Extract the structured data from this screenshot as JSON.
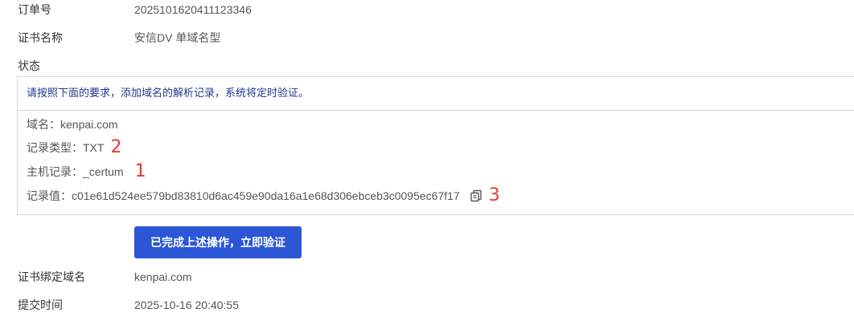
{
  "order": {
    "label": "订单号",
    "value": "2025101620411123346"
  },
  "cert_name": {
    "label": "证书名称",
    "value": "安信DV 单域名型"
  },
  "status": {
    "label": "状态",
    "notice": "请按照下面的要求，添加域名的解析记录，系统将定时验证。",
    "domain_label": "域名：",
    "domain_value": "kenpai.com",
    "record_type_label": "记录类型：",
    "record_type_value": "TXT",
    "host_record_label": "主机记录：",
    "host_record_value": "_certum",
    "record_value_label": "记录值：",
    "record_value": "c01e61d524ee579bd83810d6ac459e90da16a1e68d306ebceb3c0095ec67f17",
    "markers": {
      "record_type": "2",
      "host_record": "1",
      "record_value": "3"
    },
    "copy_icon": "copy-icon"
  },
  "verify_button": {
    "label": "已完成上述操作，立即验证"
  },
  "bound_domain": {
    "label": "证书绑定域名",
    "value": "kenpai.com"
  },
  "submit_time": {
    "label": "提交时间",
    "value": "2025-10-16 20:40:55"
  },
  "colors": {
    "accent": "#2b56d6",
    "marker": "#e53935",
    "notice_text": "#1f3a8a",
    "border": "#d9d9d9"
  }
}
